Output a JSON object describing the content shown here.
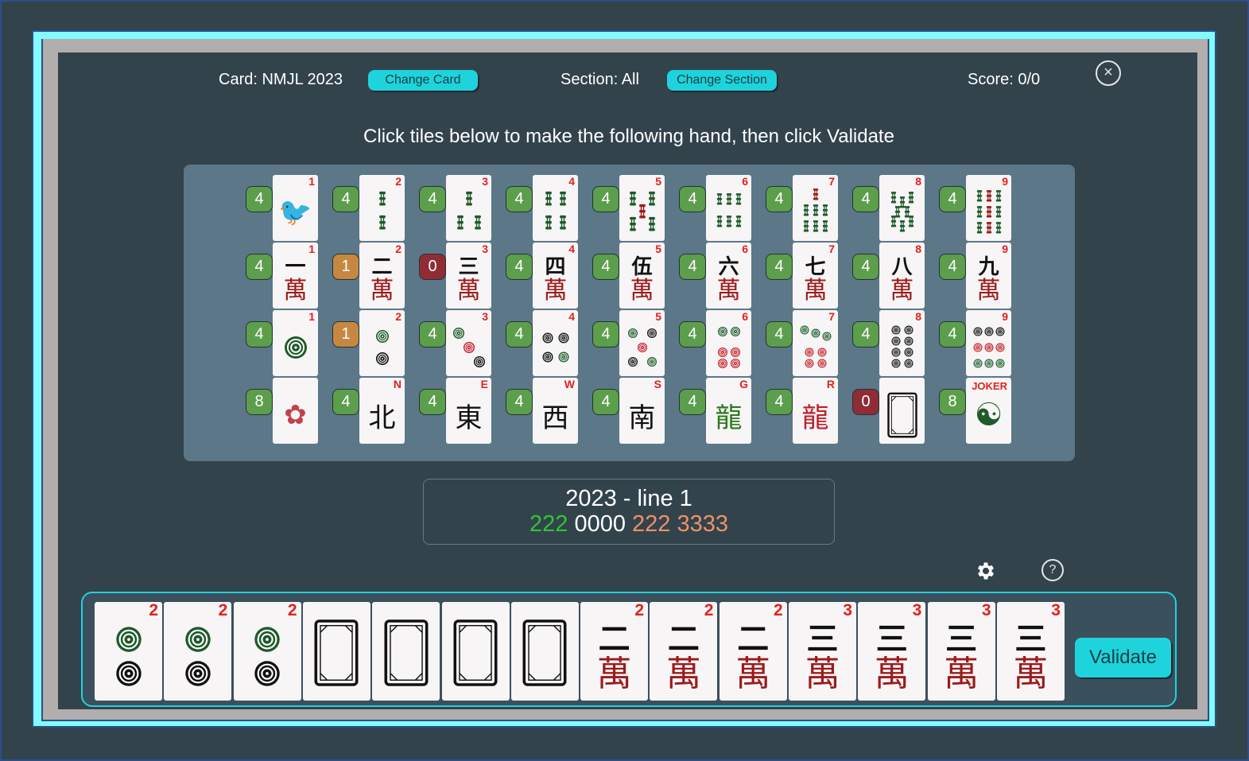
{
  "header": {
    "card_label": "Card: NMJL 2023",
    "change_card_label": "Change Card",
    "section_label": "Section: All",
    "change_section_label": "Change Section",
    "score_label": "Score: 0/0",
    "close_icon": "×"
  },
  "instructions": "Click tiles below to make the following hand, then click Validate",
  "colors": {
    "accent": "#1fd3dc",
    "badge_green": "#5c9e4c",
    "badge_orange": "#c68840",
    "badge_red": "#8f2c36",
    "tile_index_red": "#e0221d",
    "bam_green": "#1e5a2a",
    "crak_red": "#9b1b1b",
    "pattern_green": "#34c334",
    "pattern_white": "#ffffff",
    "pattern_salmon": "#f0906a"
  },
  "tile_grid": {
    "rows": [
      {
        "suit": "bam",
        "tiles": [
          {
            "index": "1",
            "name": "1 bam (bird)",
            "count": "4",
            "badge": "green",
            "glyph": "🐦"
          },
          {
            "index": "2",
            "name": "2 bam",
            "count": "4",
            "badge": "green"
          },
          {
            "index": "3",
            "name": "3 bam",
            "count": "4",
            "badge": "green"
          },
          {
            "index": "4",
            "name": "4 bam",
            "count": "4",
            "badge": "green"
          },
          {
            "index": "5",
            "name": "5 bam",
            "count": "4",
            "badge": "green"
          },
          {
            "index": "6",
            "name": "6 bam",
            "count": "4",
            "badge": "green"
          },
          {
            "index": "7",
            "name": "7 bam",
            "count": "4",
            "badge": "green"
          },
          {
            "index": "8",
            "name": "8 bam",
            "count": "4",
            "badge": "green"
          },
          {
            "index": "9",
            "name": "9 bam",
            "count": "4",
            "badge": "green"
          }
        ]
      },
      {
        "suit": "crak",
        "tiles": [
          {
            "index": "1",
            "name": "1 crak",
            "count": "4",
            "badge": "green",
            "glyph": "一"
          },
          {
            "index": "2",
            "name": "2 crak",
            "count": "1",
            "badge": "orange",
            "glyph": "二"
          },
          {
            "index": "3",
            "name": "3 crak",
            "count": "0",
            "badge": "red",
            "glyph": "三"
          },
          {
            "index": "4",
            "name": "4 crak",
            "count": "4",
            "badge": "green",
            "glyph": "四"
          },
          {
            "index": "5",
            "name": "5 crak",
            "count": "4",
            "badge": "green",
            "glyph": "伍"
          },
          {
            "index": "6",
            "name": "6 crak",
            "count": "4",
            "badge": "green",
            "glyph": "六"
          },
          {
            "index": "7",
            "name": "7 crak",
            "count": "4",
            "badge": "green",
            "glyph": "七"
          },
          {
            "index": "8",
            "name": "8 crak",
            "count": "4",
            "badge": "green",
            "glyph": "八"
          },
          {
            "index": "9",
            "name": "9 crak",
            "count": "4",
            "badge": "green",
            "glyph": "九"
          }
        ]
      },
      {
        "suit": "dot",
        "tiles": [
          {
            "index": "1",
            "name": "1 dot",
            "count": "4",
            "badge": "green"
          },
          {
            "index": "2",
            "name": "2 dot",
            "count": "1",
            "badge": "orange"
          },
          {
            "index": "3",
            "name": "3 dot",
            "count": "4",
            "badge": "green"
          },
          {
            "index": "4",
            "name": "4 dot",
            "count": "4",
            "badge": "green"
          },
          {
            "index": "5",
            "name": "5 dot",
            "count": "4",
            "badge": "green"
          },
          {
            "index": "6",
            "name": "6 dot",
            "count": "4",
            "badge": "green"
          },
          {
            "index": "7",
            "name": "7 dot",
            "count": "4",
            "badge": "green"
          },
          {
            "index": "8",
            "name": "8 dot",
            "count": "4",
            "badge": "green"
          },
          {
            "index": "9",
            "name": "9 dot",
            "count": "4",
            "badge": "green"
          }
        ]
      },
      {
        "suit": "honor",
        "tiles": [
          {
            "index": "",
            "name": "flower",
            "count": "8",
            "badge": "green",
            "glyph": "✿"
          },
          {
            "index": "N",
            "name": "north wind",
            "count": "4",
            "badge": "green",
            "glyph": "北"
          },
          {
            "index": "E",
            "name": "east wind",
            "count": "4",
            "badge": "green",
            "glyph": "東"
          },
          {
            "index": "W",
            "name": "west wind",
            "count": "4",
            "badge": "green",
            "glyph": "西"
          },
          {
            "index": "S",
            "name": "south wind",
            "count": "4",
            "badge": "green",
            "glyph": "南"
          },
          {
            "index": "G",
            "name": "green dragon",
            "count": "4",
            "badge": "green",
            "glyph": "龍"
          },
          {
            "index": "R",
            "name": "red dragon",
            "count": "4",
            "badge": "green",
            "glyph": "龍"
          },
          {
            "index": "",
            "name": "white dragon (soap)",
            "count": "0",
            "badge": "red"
          },
          {
            "index": "JOKER",
            "name": "joker",
            "count": "8",
            "badge": "green",
            "glyph": "☯"
          }
        ]
      }
    ]
  },
  "hand": {
    "title": "2023 - line 1",
    "pattern": [
      {
        "text": "222",
        "color": "green"
      },
      {
        "text": "0000",
        "color": "white"
      },
      {
        "text": "222",
        "color": "salmon"
      },
      {
        "text": "3333",
        "color": "salmon"
      }
    ]
  },
  "toolbar": {
    "settings_icon": "gear-icon",
    "help_icon": "?"
  },
  "rack": {
    "tiles": [
      {
        "index": "2",
        "name": "2 dot",
        "suit": "dot"
      },
      {
        "index": "2",
        "name": "2 dot",
        "suit": "dot"
      },
      {
        "index": "2",
        "name": "2 dot",
        "suit": "dot"
      },
      {
        "index": "",
        "name": "white dragon",
        "suit": "soap"
      },
      {
        "index": "",
        "name": "white dragon",
        "suit": "soap"
      },
      {
        "index": "",
        "name": "white dragon",
        "suit": "soap"
      },
      {
        "index": "",
        "name": "white dragon",
        "suit": "soap"
      },
      {
        "index": "2",
        "name": "2 crak",
        "suit": "crak",
        "glyph": "二"
      },
      {
        "index": "2",
        "name": "2 crak",
        "suit": "crak",
        "glyph": "二"
      },
      {
        "index": "2",
        "name": "2 crak",
        "suit": "crak",
        "glyph": "二"
      },
      {
        "index": "3",
        "name": "3 crak",
        "suit": "crak",
        "glyph": "三"
      },
      {
        "index": "3",
        "name": "3 crak",
        "suit": "crak",
        "glyph": "三"
      },
      {
        "index": "3",
        "name": "3 crak",
        "suit": "crak",
        "glyph": "三"
      },
      {
        "index": "3",
        "name": "3 crak",
        "suit": "crak",
        "glyph": "三"
      }
    ],
    "validate_label": "Validate"
  }
}
